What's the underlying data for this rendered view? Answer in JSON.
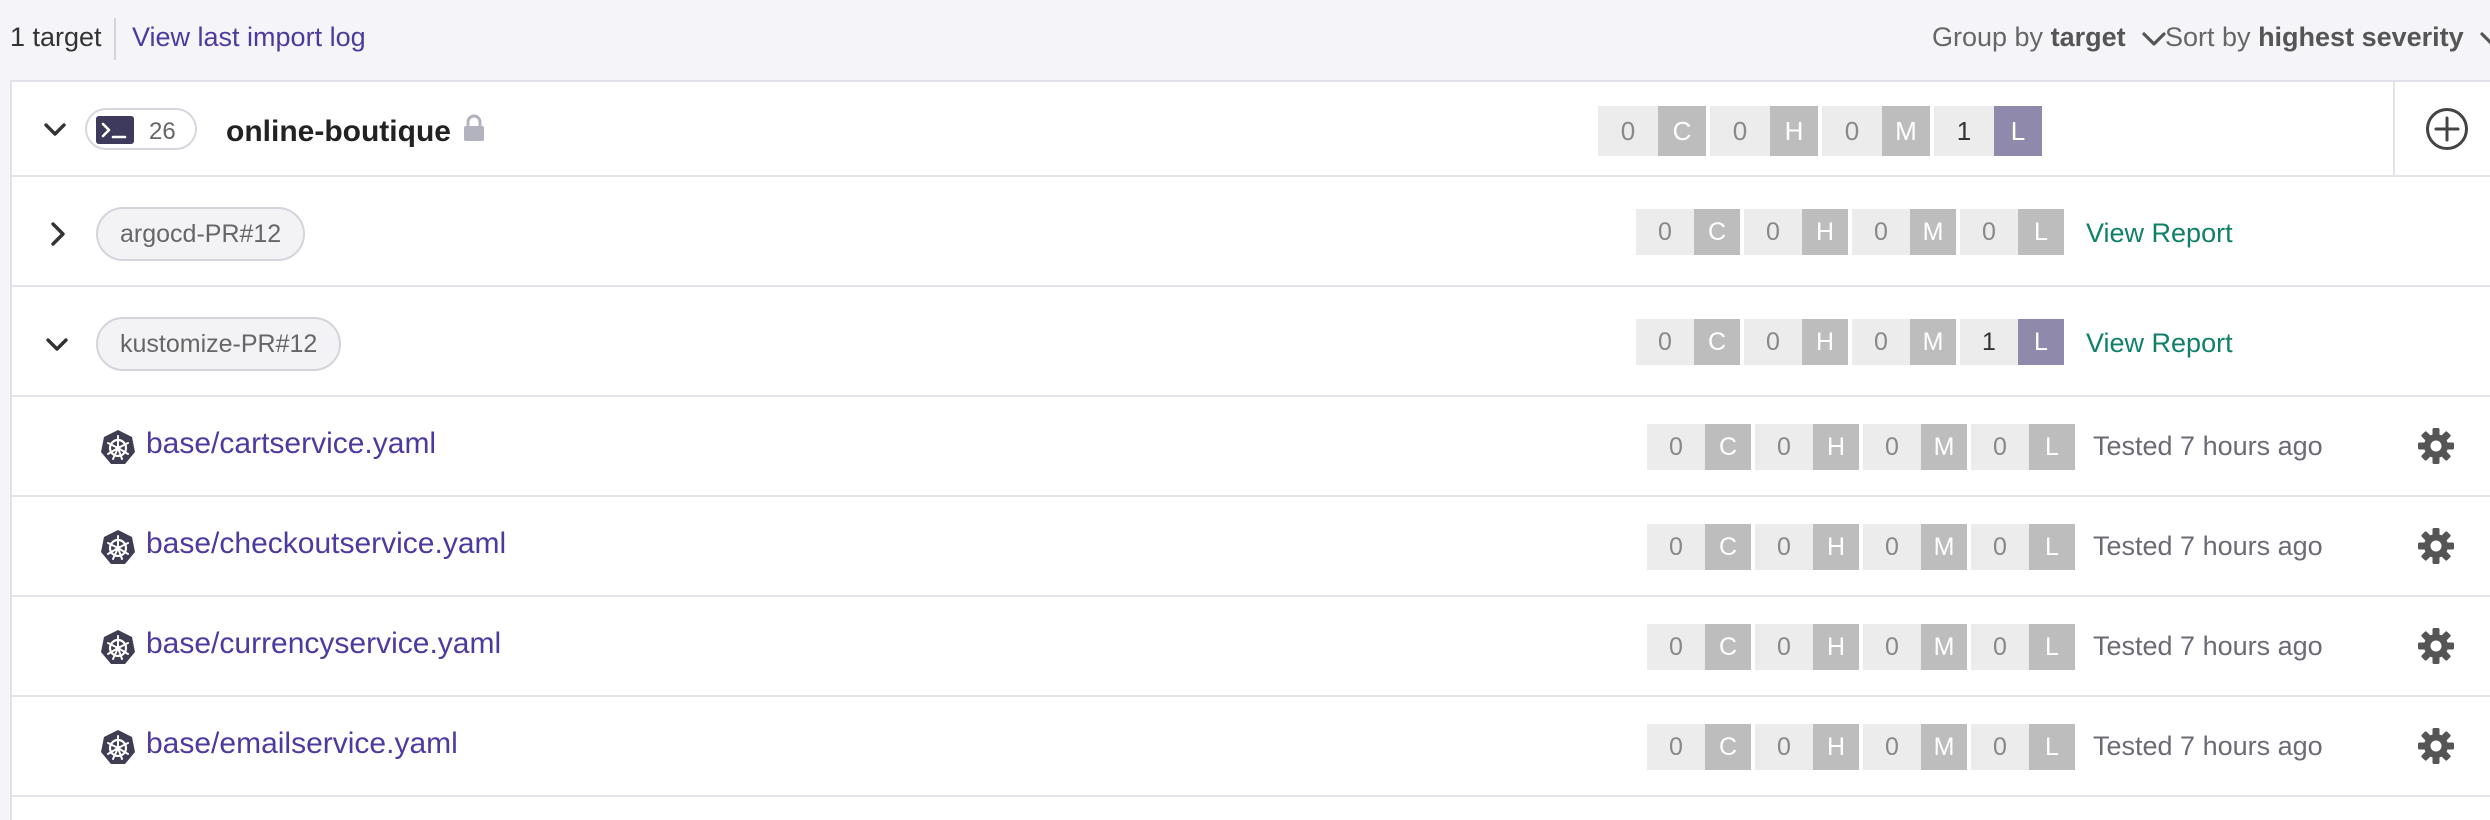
{
  "topbar": {
    "target_count": "1 target",
    "import_log_link": "View last import log",
    "group_prefix": "Group by",
    "group_value": "target",
    "sort_prefix": "Sort by",
    "sort_value": "highest severity"
  },
  "project": {
    "issue_count": "26",
    "name": "online-boutique",
    "severity": {
      "c": "0",
      "c_label": "C",
      "h": "0",
      "h_label": "H",
      "m": "0",
      "m_label": "M",
      "l": "1",
      "l_label": "L"
    }
  },
  "targets": [
    {
      "name": "argocd-PR#12",
      "link": "View Report",
      "severity": {
        "c": "0",
        "c_label": "C",
        "h": "0",
        "h_label": "H",
        "m": "0",
        "m_label": "M",
        "l": "0",
        "l_label": "L"
      }
    },
    {
      "name": "kustomize-PR#12",
      "link": "View Report",
      "severity": {
        "c": "0",
        "c_label": "C",
        "h": "0",
        "h_label": "H",
        "m": "0",
        "m_label": "M",
        "l": "1",
        "l_label": "L"
      }
    }
  ],
  "files": [
    {
      "path": "base/cartservice.yaml",
      "tested": "Tested 7 hours ago",
      "severity": {
        "c": "0",
        "c_label": "C",
        "h": "0",
        "h_label": "H",
        "m": "0",
        "m_label": "M",
        "l": "0",
        "l_label": "L"
      }
    },
    {
      "path": "base/checkoutservice.yaml",
      "tested": "Tested 7 hours ago",
      "severity": {
        "c": "0",
        "c_label": "C",
        "h": "0",
        "h_label": "H",
        "m": "0",
        "m_label": "M",
        "l": "0",
        "l_label": "L"
      }
    },
    {
      "path": "base/currencyservice.yaml",
      "tested": "Tested 7 hours ago",
      "severity": {
        "c": "0",
        "c_label": "C",
        "h": "0",
        "h_label": "H",
        "m": "0",
        "m_label": "M",
        "l": "0",
        "l_label": "L"
      }
    },
    {
      "path": "base/emailservice.yaml",
      "tested": "Tested 7 hours ago",
      "severity": {
        "c": "0",
        "c_label": "C",
        "h": "0",
        "h_label": "H",
        "m": "0",
        "m_label": "M",
        "l": "0",
        "l_label": "L"
      }
    }
  ],
  "icons": {
    "project": "terminal-icon",
    "lock": "lock-icon",
    "add": "plus-circle-icon",
    "file": "kubernetes-icon",
    "settings": "gear-icon",
    "expand": "chevron-right-icon",
    "collapse": "chevron-down-icon"
  },
  "colors": {
    "link": "#4b3ba0",
    "view_report": "#10806a",
    "low_active": "#8f8aab",
    "badge_letter": "#bdbdbd",
    "badge_count": "#ececec"
  }
}
